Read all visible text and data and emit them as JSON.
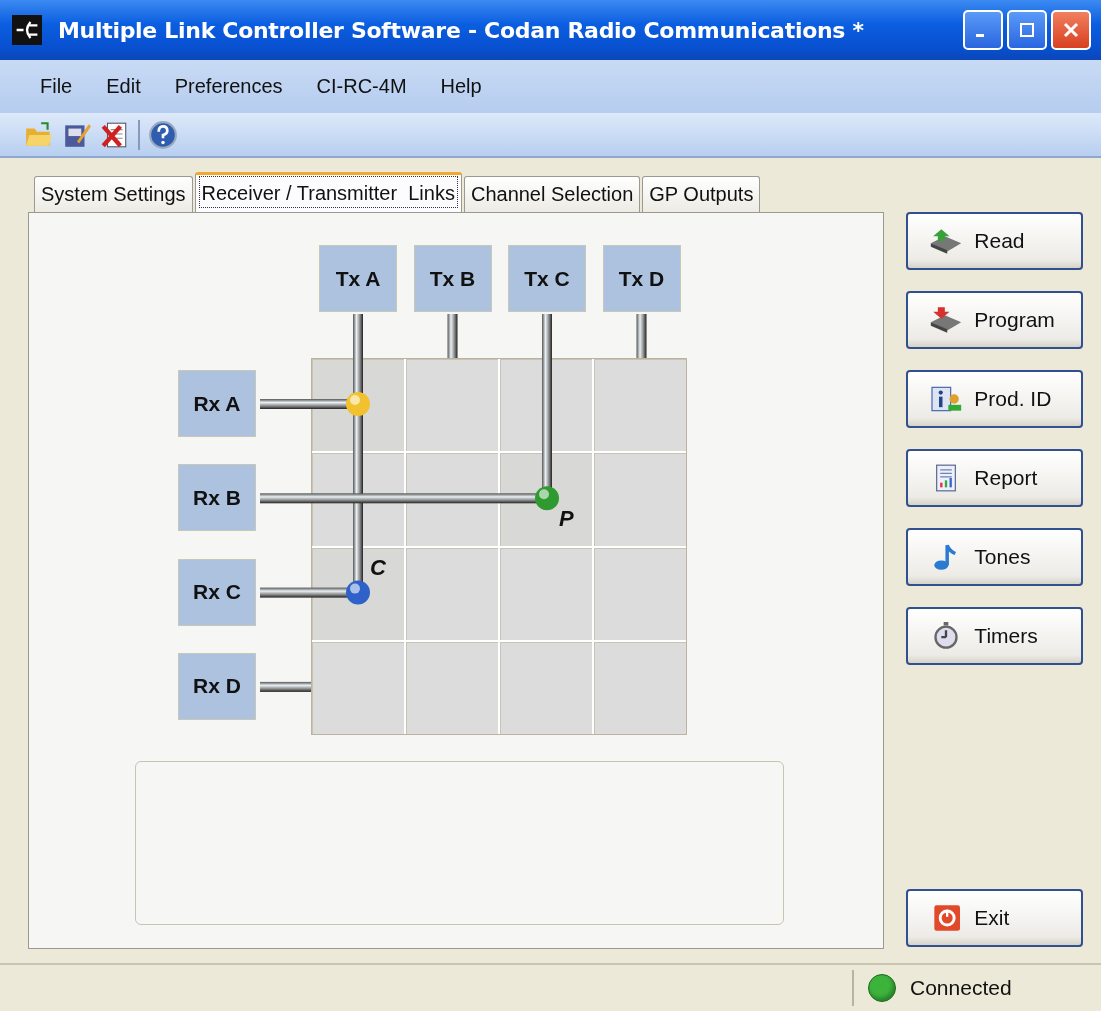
{
  "window": {
    "title": "Multiple Link Controller Software - Codan Radio Communications *"
  },
  "menu": [
    "File",
    "Edit",
    "Preferences",
    "CI-RC-4M",
    "Help"
  ],
  "tabs": [
    {
      "label": "System Settings",
      "selected": false
    },
    {
      "label": "Receiver / Transmitter  Links",
      "selected": true
    },
    {
      "label": "Channel Selection",
      "selected": false
    },
    {
      "label": "GP Outputs",
      "selected": false
    }
  ],
  "matrix": {
    "transmitters": [
      "Tx A",
      "Tx B",
      "Tx C",
      "Tx D"
    ],
    "rows": [
      {
        "label": "Rx A",
        "cells": [
          {
            "node": true,
            "color": "#f2c22e"
          },
          {
            "node": false
          },
          {
            "node": false
          },
          {
            "node": false
          }
        ]
      },
      {
        "label": "Rx B",
        "cells": [
          {
            "node": false
          },
          {
            "node": false
          },
          {
            "node": true,
            "color": "#2f9a2f",
            "tag": "P"
          },
          {
            "node": false
          }
        ]
      },
      {
        "label": "Rx C",
        "cells": [
          {
            "node": true,
            "color": "#2f62c8",
            "tag": "C"
          },
          {
            "node": false
          },
          {
            "node": false
          },
          {
            "node": false
          }
        ]
      },
      {
        "label": "Rx D",
        "cells": [
          {
            "node": false
          },
          {
            "node": false
          },
          {
            "node": false
          },
          {
            "node": false
          }
        ]
      }
    ]
  },
  "buttons": [
    {
      "label": "Read",
      "kind": "read"
    },
    {
      "label": "Program",
      "kind": "program"
    },
    {
      "label": "Prod. ID",
      "kind": "prodid"
    },
    {
      "label": "Report",
      "kind": "report"
    },
    {
      "label": "Tones",
      "kind": "tones"
    },
    {
      "label": "Timers",
      "kind": "timers"
    }
  ],
  "exit_button": {
    "label": "Exit"
  },
  "status_bar": {
    "text": "Connected",
    "connected": true
  }
}
